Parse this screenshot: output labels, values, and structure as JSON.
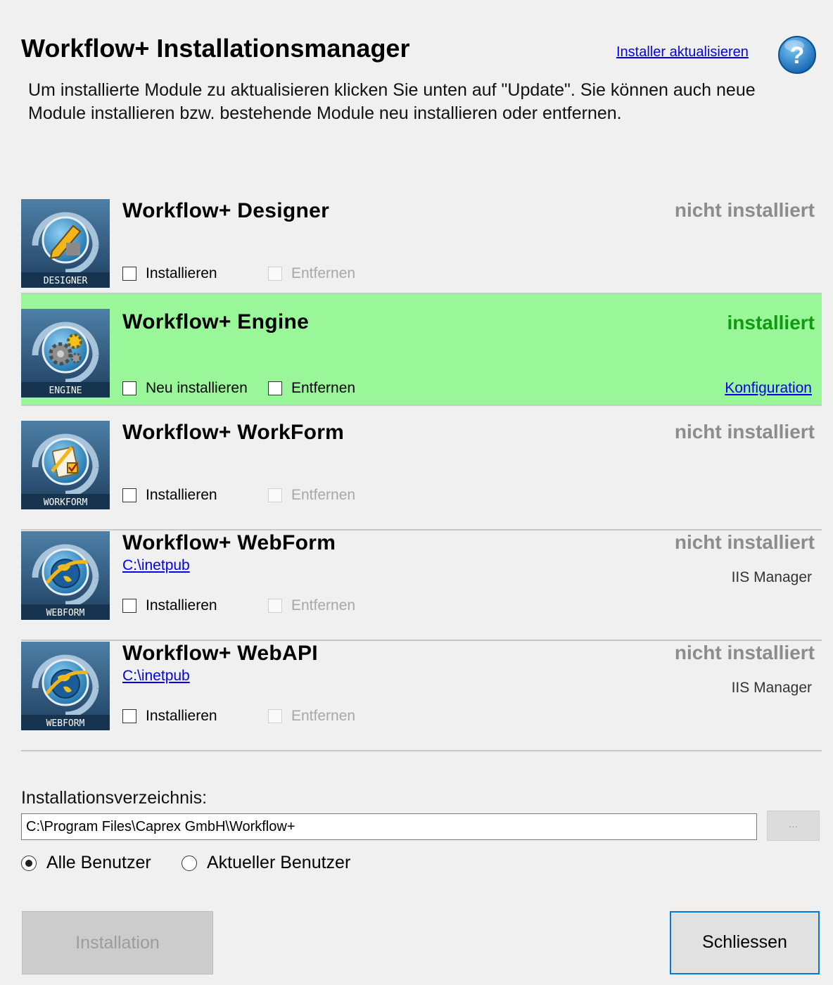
{
  "header": {
    "title": "Workflow+ Installationsmanager",
    "update_link": "Installer aktualisieren",
    "help_icon": "question-circle-icon",
    "intro": "Um installierte Module zu aktualisieren klicken Sie unten auf \"Update\". Sie können auch neue Module installieren bzw. bestehende Module neu installieren oder entfernen."
  },
  "modules": [
    {
      "name": "Workflow+ Designer",
      "status": "nicht installiert",
      "icon_label": "DESIGNER",
      "icon": "pencil-icon",
      "checkbox1": "Installieren",
      "checkbox2": "Entfernen"
    },
    {
      "name": "Workflow+ Engine",
      "status": "installiert",
      "icon_label": "ENGINE",
      "icon": "gears-icon",
      "checkbox1": "Neu installieren",
      "checkbox2": "Entfernen",
      "link": "Konfiguration"
    },
    {
      "name": "Workflow+ WorkForm",
      "status": "nicht installiert",
      "icon_label": "WORKFORM",
      "icon": "clipboard-icon",
      "checkbox1": "Installieren",
      "checkbox2": "Entfernen"
    },
    {
      "name": "Workflow+ WebForm",
      "status": "nicht installiert",
      "icon_label": "WEBFORM",
      "icon": "globe-icon",
      "path": "C:\\inetpub",
      "side": "IIS Manager",
      "checkbox1": "Installieren",
      "checkbox2": "Entfernen"
    },
    {
      "name": "Workflow+ WebAPI",
      "status": "nicht installiert",
      "icon_label": "WEBFORM",
      "icon": "globe-icon",
      "path": "C:\\inetpub",
      "side": "IIS Manager",
      "checkbox1": "Installieren",
      "checkbox2": "Entfernen"
    }
  ],
  "directory": {
    "label": "Installationsverzeichnis:",
    "value": "C:\\Program Files\\Caprex GmbH\\Workflow+",
    "browse": "..."
  },
  "scope": {
    "all_users": "Alle Benutzer",
    "current_user": "Aktueller Benutzer",
    "selected": "all_users"
  },
  "buttons": {
    "install": "Installation",
    "close": "Schliessen"
  },
  "colors": {
    "installed_bg": "#99f799",
    "installed_text": "#119a11",
    "not_installed_text": "#8c8c8c",
    "link": "#0000ee",
    "focus_border": "#0078d7"
  }
}
